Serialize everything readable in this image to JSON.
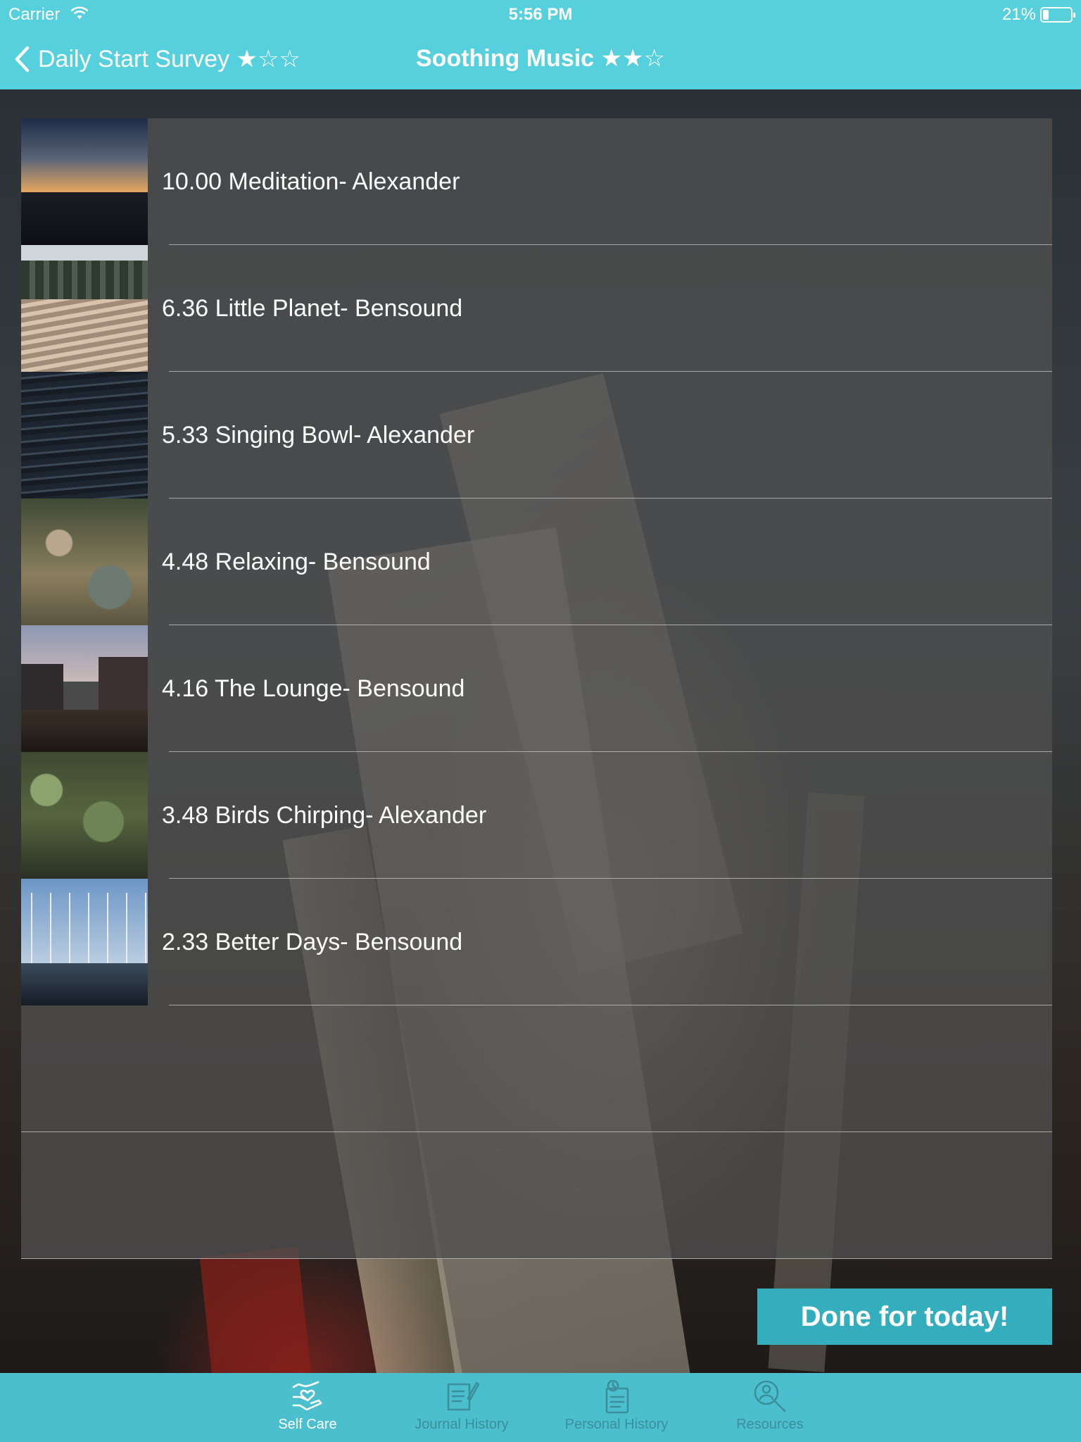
{
  "status_bar": {
    "carrier": "Carrier",
    "time": "5:56 PM",
    "battery": "21%",
    "battery_level": 0.21
  },
  "nav": {
    "back_label": "Daily Start Survey ★☆☆",
    "title": "Soothing Music ★★☆"
  },
  "tracks": [
    {
      "label": "10.00 Meditation- Alexander",
      "thumb": "sunset-over-water"
    },
    {
      "label": "6.36 Little Planet- Bensound",
      "thumb": "trees-over-railway"
    },
    {
      "label": "5.33 Singing Bowl- Alexander",
      "thumb": "ocean-waves"
    },
    {
      "label": "4.48 Relaxing- Bensound",
      "thumb": "rocks-and-plants"
    },
    {
      "label": "4.16 The Lounge- Bensound",
      "thumb": "street-at-dusk"
    },
    {
      "label": "3.48 Birds Chirping- Alexander",
      "thumb": "forest-stream"
    },
    {
      "label": "2.33 Better Days- Bensound",
      "thumb": "marina-sailboats"
    }
  ],
  "done_button": "Done for today!",
  "tabs": [
    {
      "label": "Self Care",
      "icon": "hands-heart-icon",
      "active": true
    },
    {
      "label": "Journal History",
      "icon": "journal-icon",
      "active": false
    },
    {
      "label": "Personal History",
      "icon": "clipboard-clock-icon",
      "active": false
    },
    {
      "label": "Resources",
      "icon": "person-search-icon",
      "active": false
    }
  ],
  "colors": {
    "header": "#57d0dd",
    "tabbar": "#4cbfce",
    "done_button": "#34aebd",
    "inactive_tab": "#3a8f9a"
  }
}
